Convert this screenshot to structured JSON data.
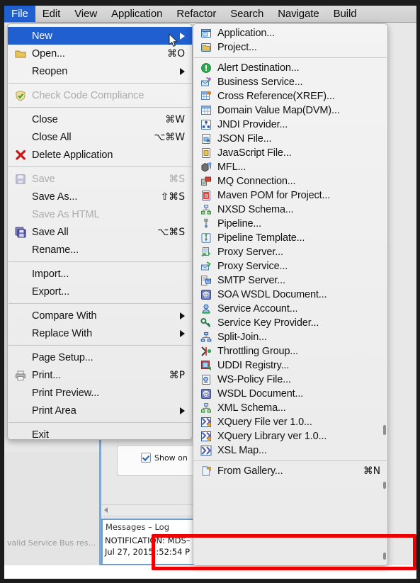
{
  "menubar": {
    "items": [
      {
        "label": "File",
        "active": true
      },
      {
        "label": "Edit",
        "active": false
      },
      {
        "label": "View",
        "active": false
      },
      {
        "label": "Application",
        "active": false
      },
      {
        "label": "Refactor",
        "active": false
      },
      {
        "label": "Search",
        "active": false
      },
      {
        "label": "Navigate",
        "active": false
      },
      {
        "label": "Build",
        "active": false
      }
    ]
  },
  "file_menu": {
    "items": [
      {
        "label": "New",
        "accel": "",
        "icon": "none",
        "state": "selected",
        "submenu": true
      },
      {
        "label": "Open...",
        "accel": "⌘O",
        "icon": "folder-open-icon",
        "state": "normal",
        "submenu": false
      },
      {
        "label": "Reopen",
        "accel": "",
        "icon": "none",
        "state": "normal",
        "submenu": true
      },
      {
        "type": "separator"
      },
      {
        "label": "Check Code Compliance",
        "accel": "",
        "icon": "shield-check-icon",
        "state": "disabled",
        "submenu": false
      },
      {
        "type": "separator"
      },
      {
        "label": "Close",
        "accel": "⌘W",
        "icon": "none",
        "state": "normal",
        "submenu": false
      },
      {
        "label": "Close All",
        "accel": "⌥⌘W",
        "icon": "none",
        "state": "normal",
        "submenu": false
      },
      {
        "label": "Delete Application",
        "accel": "",
        "icon": "red-x-icon",
        "state": "normal",
        "submenu": false
      },
      {
        "type": "separator"
      },
      {
        "label": "Save",
        "accel": "⌘S",
        "icon": "save-disk-icon",
        "state": "disabled",
        "submenu": false
      },
      {
        "label": "Save As...",
        "accel": "⇧⌘S",
        "icon": "none",
        "state": "normal",
        "submenu": false
      },
      {
        "label": "Save As HTML",
        "accel": "",
        "icon": "none",
        "state": "disabled",
        "submenu": false
      },
      {
        "label": "Save All",
        "accel": "⌥⌘S",
        "icon": "save-all-icon",
        "state": "normal",
        "submenu": false
      },
      {
        "label": "Rename...",
        "accel": "",
        "icon": "none",
        "state": "normal",
        "submenu": false
      },
      {
        "type": "separator"
      },
      {
        "label": "Import...",
        "accel": "",
        "icon": "none",
        "state": "normal",
        "submenu": false
      },
      {
        "label": "Export...",
        "accel": "",
        "icon": "none",
        "state": "normal",
        "submenu": false
      },
      {
        "type": "separator"
      },
      {
        "label": "Compare With",
        "accel": "",
        "icon": "none",
        "state": "normal",
        "submenu": true
      },
      {
        "label": "Replace With",
        "accel": "",
        "icon": "none",
        "state": "normal",
        "submenu": true
      },
      {
        "type": "separator"
      },
      {
        "label": "Page Setup...",
        "accel": "",
        "icon": "none",
        "state": "normal",
        "submenu": false
      },
      {
        "label": "Print...",
        "accel": "⌘P",
        "icon": "printer-icon",
        "state": "normal",
        "submenu": false
      },
      {
        "label": "Print Preview...",
        "accel": "",
        "icon": "none",
        "state": "normal",
        "submenu": false
      },
      {
        "label": "Print Area",
        "accel": "",
        "icon": "none",
        "state": "normal",
        "submenu": true
      },
      {
        "type": "separator"
      },
      {
        "label": "Exit",
        "accel": "",
        "icon": "none",
        "state": "normal",
        "submenu": false
      }
    ]
  },
  "new_submenu": {
    "items": [
      {
        "label": "Application...",
        "accel": "",
        "icon": "application-icon"
      },
      {
        "label": "Project...",
        "accel": "",
        "icon": "project-folder-icon"
      },
      {
        "type": "separator"
      },
      {
        "label": "Alert Destination...",
        "accel": "",
        "icon": "alert-icon"
      },
      {
        "label": "Business Service...",
        "accel": "",
        "icon": "business-service-icon"
      },
      {
        "label": "Cross Reference(XREF)...",
        "accel": "",
        "icon": "xref-grid-icon"
      },
      {
        "label": "Domain Value Map(DVM)...",
        "accel": "",
        "icon": "dvm-grid-icon"
      },
      {
        "label": "JNDI Provider...",
        "accel": "",
        "icon": "jndi-provider-icon"
      },
      {
        "label": "JSON File...",
        "accel": "",
        "icon": "json-file-icon"
      },
      {
        "label": "JavaScript File...",
        "accel": "",
        "icon": "javascript-file-icon"
      },
      {
        "label": "MFL...",
        "accel": "",
        "icon": "mfl-icon"
      },
      {
        "label": "MQ Connection...",
        "accel": "",
        "icon": "mq-connection-icon"
      },
      {
        "label": "Maven POM for Project...",
        "accel": "",
        "icon": "maven-pom-icon"
      },
      {
        "label": "NXSD Schema...",
        "accel": "",
        "icon": "nxsd-schema-icon"
      },
      {
        "label": "Pipeline...",
        "accel": "",
        "icon": "pipeline-icon"
      },
      {
        "label": "Pipeline Template...",
        "accel": "",
        "icon": "pipeline-template-icon"
      },
      {
        "label": "Proxy Server...",
        "accel": "",
        "icon": "proxy-server-icon"
      },
      {
        "label": "Proxy Service...",
        "accel": "",
        "icon": "proxy-service-icon"
      },
      {
        "label": "SMTP Server...",
        "accel": "",
        "icon": "smtp-server-icon"
      },
      {
        "label": "SOA WSDL Document...",
        "accel": "",
        "icon": "soa-wsdl-icon"
      },
      {
        "label": "Service Account...",
        "accel": "",
        "icon": "service-account-icon"
      },
      {
        "label": "Service Key Provider...",
        "accel": "",
        "icon": "service-key-icon"
      },
      {
        "label": "Split-Join...",
        "accel": "",
        "icon": "split-join-icon"
      },
      {
        "label": "Throttling Group...",
        "accel": "",
        "icon": "throttling-group-icon"
      },
      {
        "label": "UDDI Registry...",
        "accel": "",
        "icon": "uddi-registry-icon"
      },
      {
        "label": "WS-Policy File...",
        "accel": "",
        "icon": "ws-policy-icon"
      },
      {
        "label": "WSDL Document...",
        "accel": "",
        "icon": "wsdl-document-icon"
      },
      {
        "label": "XML Schema...",
        "accel": "",
        "icon": "xml-schema-icon"
      },
      {
        "label": "XQuery File ver 1.0...",
        "accel": "",
        "icon": "xquery-file-icon"
      },
      {
        "label": "XQuery Library ver 1.0...",
        "accel": "",
        "icon": "xquery-library-icon"
      },
      {
        "label": "XSL Map...",
        "accel": "",
        "icon": "xsl-map-icon"
      },
      {
        "type": "separator"
      },
      {
        "label": "From Gallery...",
        "accel": "⌘N",
        "icon": "from-gallery-icon"
      }
    ]
  },
  "background": {
    "status_text": "valid Service Bus res...",
    "checkbox_label": "Show on",
    "log_tab_label": "Messages – Log",
    "log_line_1": "NOTIFICATION: MDS–",
    "log_line_2": "Jul 27, 2015  :52:54 P"
  },
  "annotation": {
    "color": "#ef0000",
    "target_label": "From Gallery..."
  }
}
